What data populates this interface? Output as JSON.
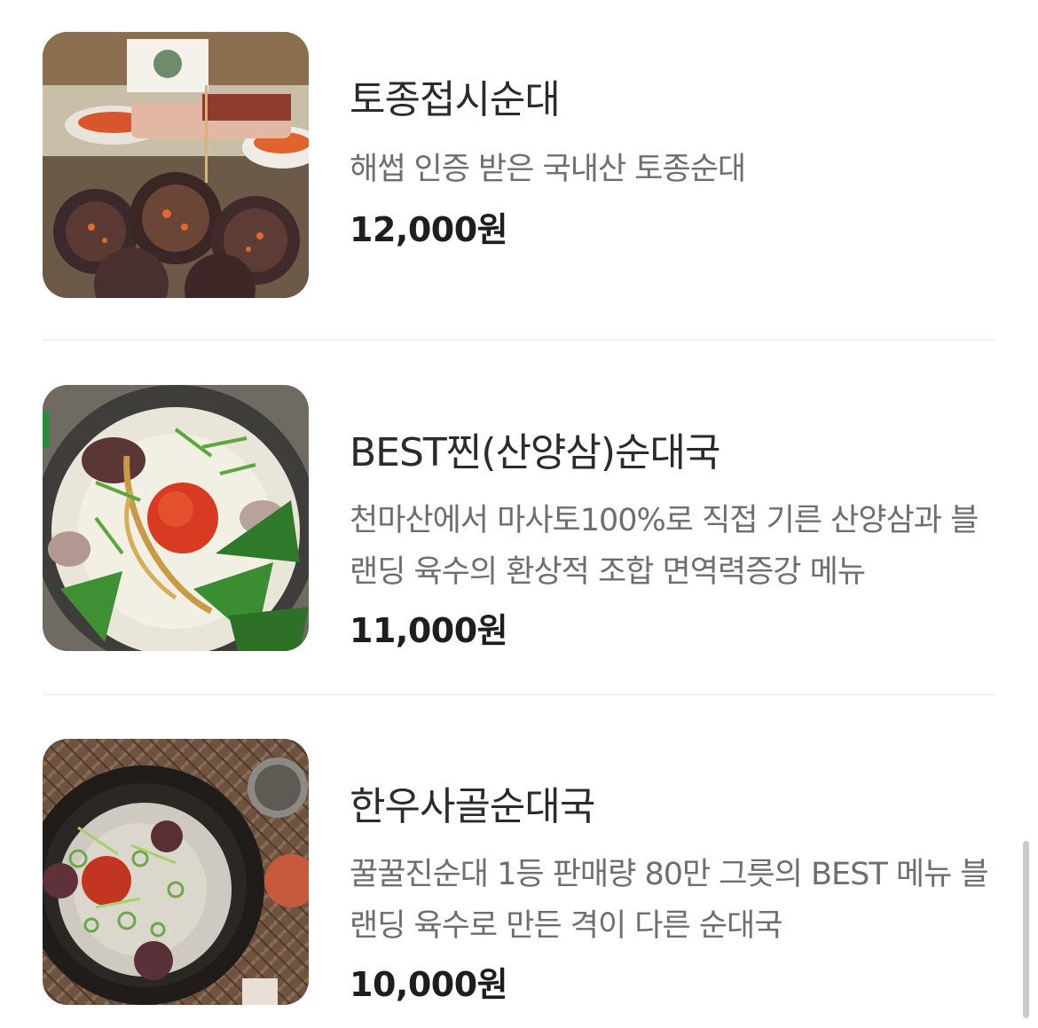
{
  "menu": {
    "items": [
      {
        "name": "토종접시순대",
        "description": "해썹 인증 받은 국내산 토종순대",
        "price": "12,000원",
        "image": "sundae-platter-photo"
      },
      {
        "name": "BEST찐(산양삼)순대국",
        "description": "천마산에서 마사토100%로 직접 기른 산양삼과 블랜딩 육수의 환상적 조합 면역력증강 메뉴",
        "price": "11,000원",
        "image": "wild-ginseng-sundaeguk-photo"
      },
      {
        "name": "한우사골순대국",
        "description": "꿀꿀진순대 1등 판매량 80만 그릇의 BEST 메뉴 블랜딩 육수로 만든 격이 다른 순대국",
        "price": "10,000원",
        "image": "hanwoo-bone-broth-sundaeguk-photo"
      }
    ]
  }
}
